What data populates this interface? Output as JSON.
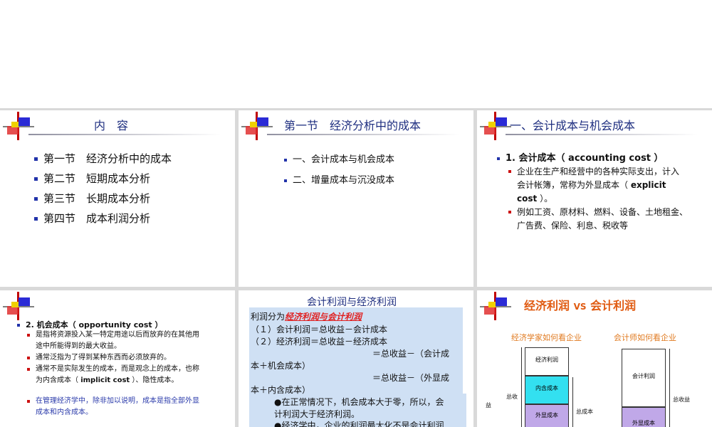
{
  "slide1": {
    "title": "内　容",
    "items": [
      "第一节　经济分析中的成本",
      "第二节　短期成本分析",
      "第三节　长期成本分析",
      "第四节　成本利润分析"
    ]
  },
  "slide2": {
    "title": "第一节　经济分析中的成本",
    "items": [
      "一、会计成本与机会成本",
      "二、增量成本与沉没成本"
    ]
  },
  "slide3": {
    "title": "一、会计成本与机会成本",
    "head_prefix": "1. 会计成本（ ",
    "head_en": "accounting cost",
    "head_suffix": " ）",
    "sub1_a": "企业在生产和经营中的各种实际支出，计入",
    "sub1_b": "会计帐簿，常称为外显成本（ ",
    "sub1_en": "explicit",
    "sub1_c": "cost",
    "sub1_d": " ）。",
    "sub2_a": "例如工资、原材料、燃料、设备、土地租金、",
    "sub2_b": "广告费、保险、利息、税收等"
  },
  "slide4": {
    "head_prefix": "2. 机会成本（ ",
    "head_en": "opportunity cost",
    "head_suffix": " ）",
    "sub1_a": "是指将资源投入某一特定用途以后而放弃的在其他用",
    "sub1_b": "途中所能得到的最大收益。",
    "sub2": "通常泛指为了得到某种东西而必须放弃的。",
    "sub3_a": "通常不是实际发生的成本，而是观念上的成本，也称",
    "sub3_b": "为内含成本（ ",
    "sub3_en": "implicit cost",
    "sub3_c": " ）、隐性成本。",
    "note_a": "在管理经济学中，除非加以说明，成本是指全部外显",
    "note_b": "成本和内含成本。"
  },
  "slide5": {
    "title": "会计利润与经济利润",
    "l1_prefix": "利润分为",
    "l1_red": "经济利润与会计利润",
    "l2": "（１）会计利润＝总收益－会计成本",
    "l3": "（２）经济利润＝总收益－经济成本",
    "l4": "＝总收益－（会计成",
    "l5": "本＋机会成本）",
    "l6": "＝总收益－（外显成",
    "l7": "本＋内含成本）",
    "l8": "●在正常情况下，机会成本大于零，所以，会",
    "l9": "计利润大于经济利润。",
    "l10": "●经济学中，企业的利润最大化不是会计利润"
  },
  "slide6": {
    "title": "经济利润",
    "vs": "VS",
    "title2": "会计利润",
    "left_caption": "经济学家如何看企业",
    "right_caption": "会计师如何看企业",
    "econ_profit": "经济利润",
    "implicit_cost": "内含成本",
    "explicit_cost_l": "外显成本",
    "total_revenue_l": "总收",
    "total_revenue_l2": "益",
    "total_cost": "总成本",
    "acct_profit": "会计利润",
    "explicit_cost_r": "外显成本",
    "total_revenue_r": "总收益",
    "colors": {
      "implicit": "#33e0f0",
      "explicit": "#c0a8e8",
      "title": "#e05a10"
    }
  }
}
